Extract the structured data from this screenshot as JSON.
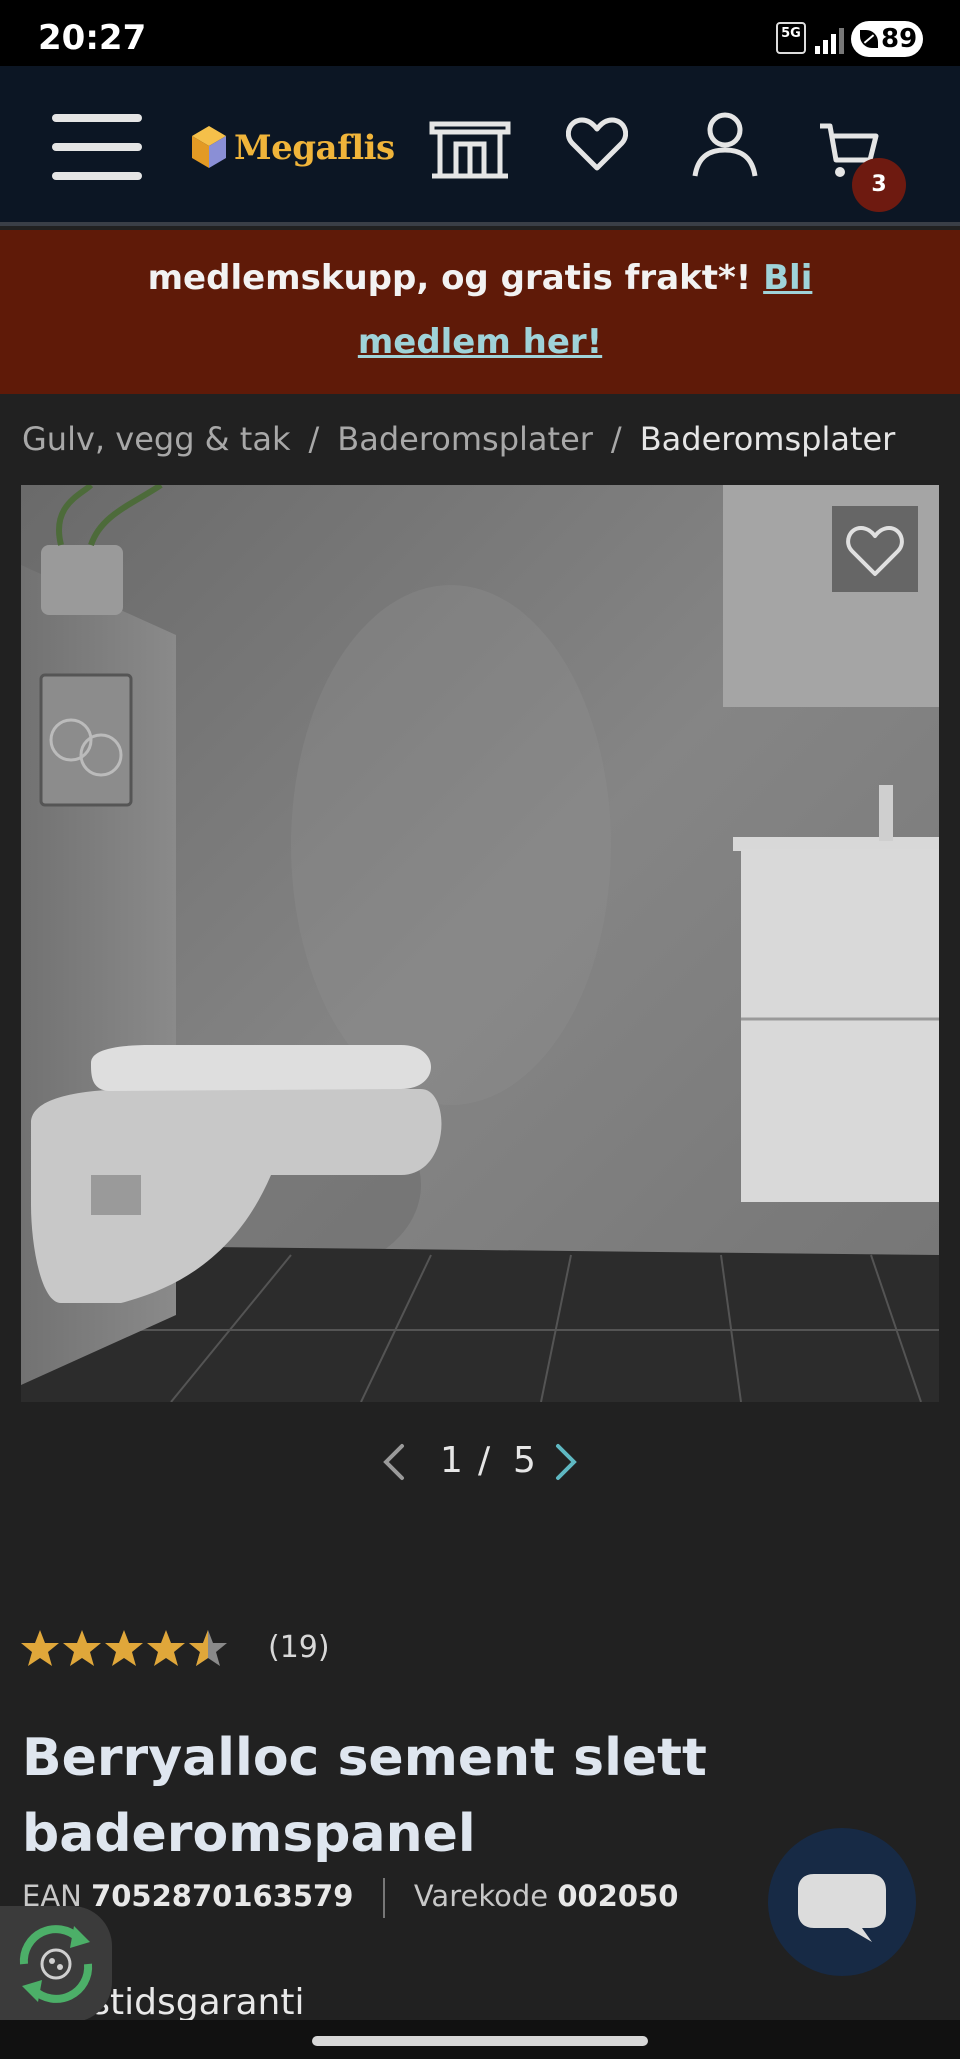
{
  "status_bar": {
    "time": "20:27",
    "network": "5G",
    "battery": "89"
  },
  "header": {
    "logo_text": "Megaflis",
    "cart_count": "3",
    "icons": [
      "menu-icon",
      "store-icon",
      "heart-icon",
      "user-icon",
      "cart-icon"
    ]
  },
  "promo": {
    "line1": "medlemskupp, og gratis frakt*! ",
    "link_part1": "Bli",
    "link_part2": "medlem her!"
  },
  "breadcrumb": {
    "items": [
      "Gulv, vegg & tak",
      "Baderomsplater",
      "Baderomsplater"
    ],
    "separator": "/"
  },
  "gallery": {
    "current": "1",
    "separator": "/",
    "total": "5"
  },
  "product": {
    "rating": 4.5,
    "rating_max": 5,
    "review_count": "(19)",
    "title_line1": "Berryalloc sement slett",
    "title_line2": "baderomspanel",
    "ean_label": "EAN",
    "ean_value": "7052870163579",
    "sku_label": "Varekode",
    "sku_value": "002050",
    "warranty_partial": "vstidsgaranti"
  },
  "colors": {
    "header_bg": "#0c1624",
    "promo_bg": "#5f1a08",
    "accent_gold": "#f0b43a",
    "link_teal": "#9fd3d9",
    "star": "#e0a73a",
    "page_bg": "#212121"
  }
}
